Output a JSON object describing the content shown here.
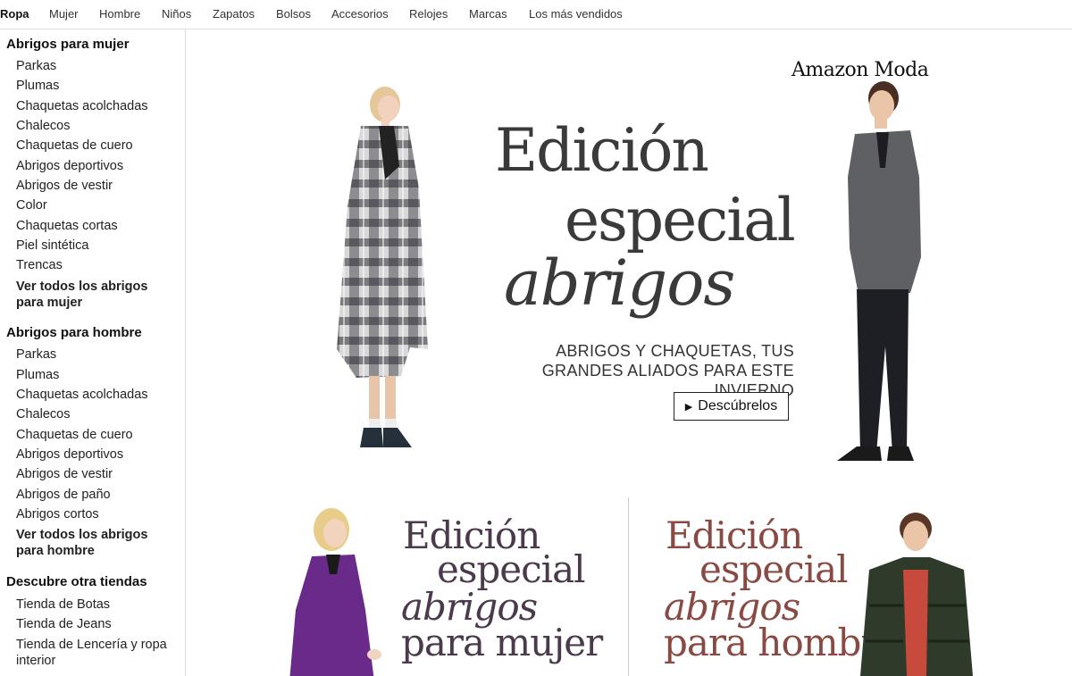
{
  "nav": {
    "items": [
      "Ropa",
      "Mujer",
      "Hombre",
      "Niños",
      "Zapatos",
      "Bolsos",
      "Accesorios",
      "Relojes",
      "Marcas",
      "Los más vendidos"
    ]
  },
  "sidebar": {
    "women": {
      "heading": "Abrigos para mujer",
      "links": [
        "Parkas",
        "Plumas",
        "Chaquetas acolchadas",
        "Chalecos",
        "Chaquetas de cuero",
        "Abrigos deportivos",
        "Abrigos de vestir",
        "Color",
        "Chaquetas cortas",
        "Piel sintética",
        "Trencas"
      ],
      "see_all": "Ver todos los abrigos para mujer"
    },
    "men": {
      "heading": "Abrigos para hombre",
      "links": [
        "Parkas",
        "Plumas",
        "Chaquetas acolchadas",
        "Chalecos",
        "Chaquetas de cuero",
        "Abrigos deportivos",
        "Abrigos de vestir",
        "Abrigos de paño",
        "Abrigos cortos"
      ],
      "see_all": "Ver todos los abrigos para hombre"
    },
    "stores": {
      "heading": "Descubre otra tiendas",
      "links": [
        "Tienda de Botas",
        "Tienda de Jeans",
        "Tienda de Lencería y ropa interior"
      ]
    }
  },
  "hero": {
    "brand": "Amazon Moda",
    "title_line1": "Edición",
    "title_line2": "especial",
    "title_line3": "abrigos",
    "subtitle_line1": "ABRIGOS Y CHAQUETAS, TUS",
    "subtitle_line2": "GRANDES ALIADOS PARA ESTE INVIERNO",
    "cta_label": "Descúbrelos"
  },
  "promos": {
    "women": {
      "l1": "Edición",
      "l2": "especial",
      "l3": "abrigos",
      "l4": "para mujer"
    },
    "men": {
      "l1": "Edición",
      "l2": "especial",
      "l3": "abrigos",
      "l4": "para hombre"
    }
  },
  "colors": {
    "women_promo": "#4a3a4c",
    "men_promo": "#8a4a44",
    "women_coat": "#6a2a8a",
    "men_jacket": "#2e3a2a"
  }
}
